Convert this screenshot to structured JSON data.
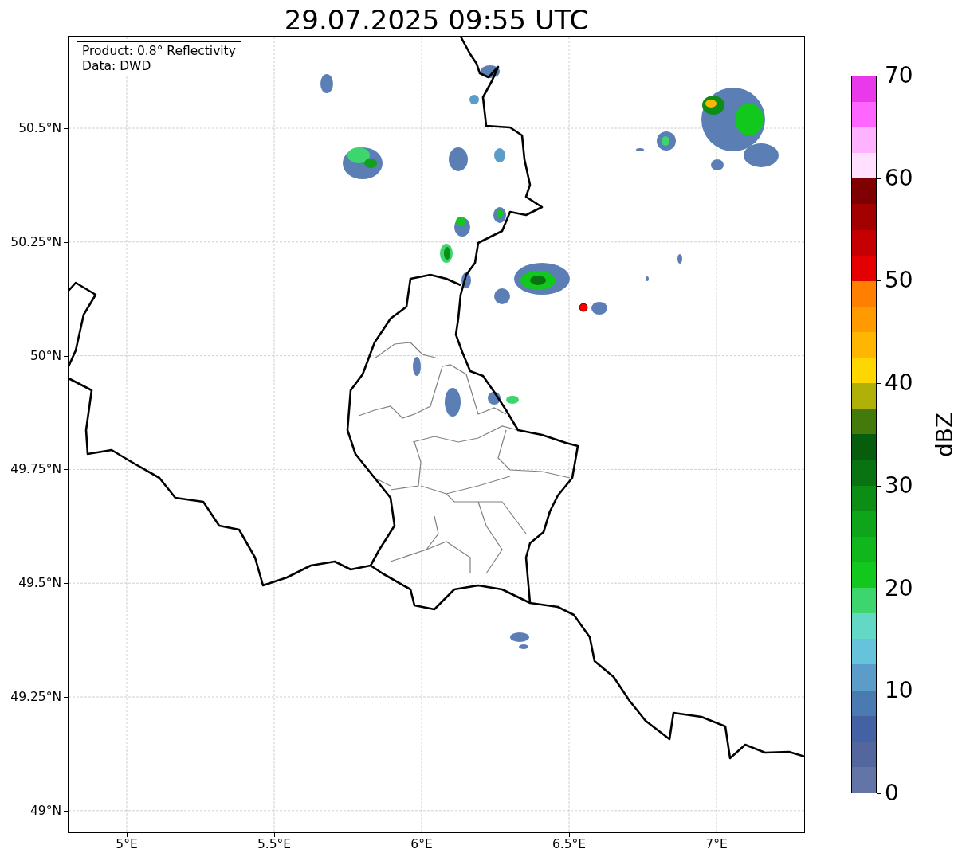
{
  "title": "29.07.2025 09:55 UTC",
  "info_box": {
    "lines": [
      "Product: 0.8° Reflectivity",
      "Data: DWD"
    ]
  },
  "map": {
    "lat_ticks": [
      "50.5°N",
      "50.25°N",
      "50°N",
      "49.75°N",
      "49.5°N",
      "49.25°N",
      "49°N"
    ],
    "lon_ticks": [
      "5°E",
      "5.5°E",
      "6°E",
      "6.5°E",
      "7°E"
    ]
  },
  "colorbar": {
    "label": "dBZ",
    "ticks": [
      "70",
      "60",
      "50",
      "40",
      "30",
      "20",
      "10",
      "0"
    ],
    "bins": [
      {
        "color": "#6374a6"
      },
      {
        "color": "#53679e"
      },
      {
        "color": "#4461a3"
      },
      {
        "color": "#4b7ab2"
      },
      {
        "color": "#5b9dc8"
      },
      {
        "color": "#67c2dc"
      },
      {
        "color": "#62d8c5"
      },
      {
        "color": "#3dd56e"
      },
      {
        "color": "#12c81c"
      },
      {
        "color": "#10b61b"
      },
      {
        "color": "#0ea51a"
      },
      {
        "color": "#0c8d16"
      },
      {
        "color": "#097312"
      },
      {
        "color": "#065e0d"
      },
      {
        "color": "#447a0c"
      },
      {
        "color": "#b0b108"
      },
      {
        "color": "#ffd700"
      },
      {
        "color": "#ffb600"
      },
      {
        "color": "#ff9a00"
      },
      {
        "color": "#ff7f00"
      },
      {
        "color": "#e50000"
      },
      {
        "color": "#c40000"
      },
      {
        "color": "#a30000"
      },
      {
        "color": "#7f0000"
      },
      {
        "color": "#ffe0ff"
      },
      {
        "color": "#ffb3ff"
      },
      {
        "color": "#ff66ff"
      },
      {
        "color": "#e83ae8"
      }
    ]
  }
}
